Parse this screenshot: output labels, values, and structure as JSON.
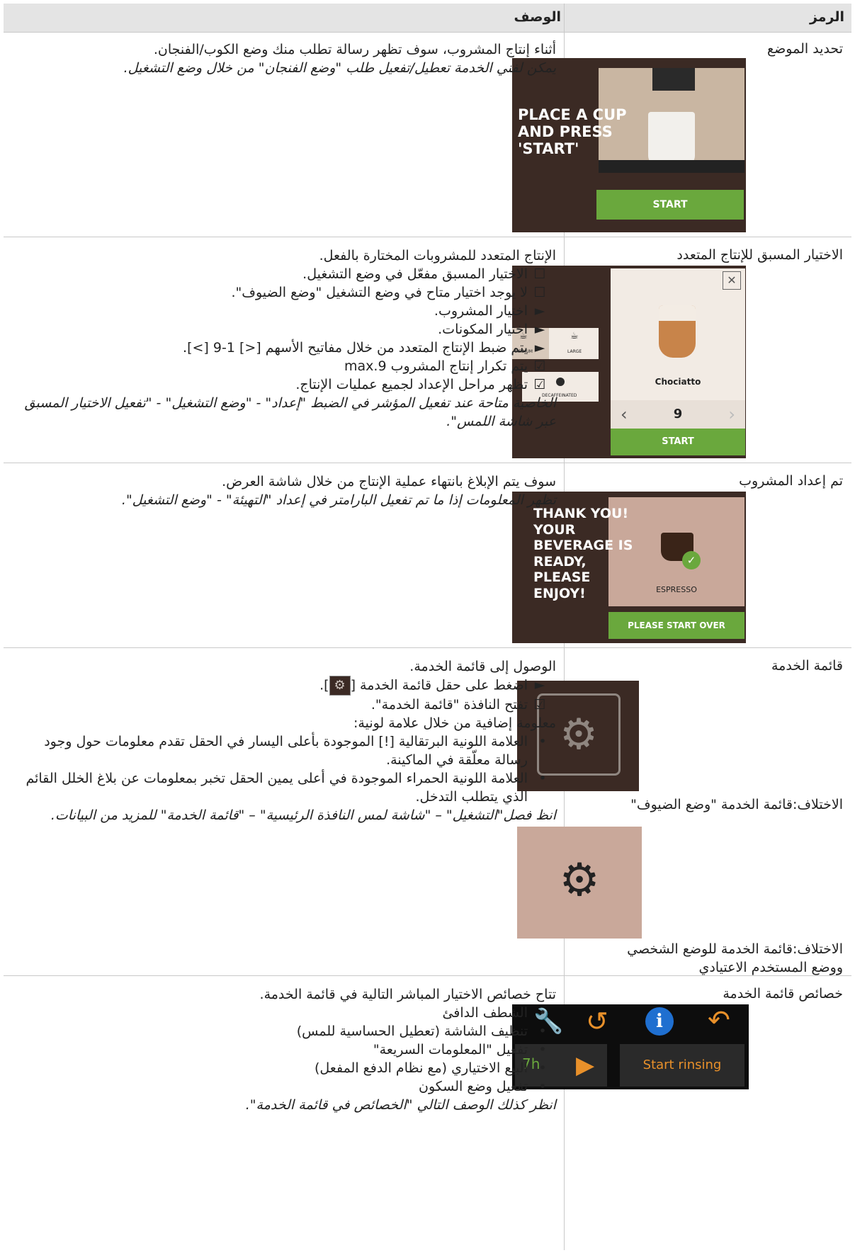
{
  "header": {
    "symbol": "الرمز",
    "description": "الوصف"
  },
  "rows": [
    {
      "symbol_title": "تحديد الموضع",
      "screen": {
        "text_lines": [
          "PLACE A CUP",
          "AND PRESS",
          "'START'"
        ],
        "button": "START"
      },
      "desc": [
        "أثناء إنتاج المشروب، سوف تظهر رسالة تطلب منك وضع الكوب/الفنجان.",
        "يمكن لفني الخدمة تعطيل/تفعيل طلب \"وضع الفنجان\" من خلال وضع التشغيل."
      ]
    },
    {
      "symbol_title": "الاختيار المسبق للإنتاج المتعدد",
      "screen": {
        "close": "✕",
        "medium": "MEDIUM",
        "large": "LARGE",
        "decaf": "DECAFFEINATED",
        "drink": "Chociatto",
        "count": "9",
        "prev": "‹",
        "next": "›",
        "button": "START"
      },
      "desc_intro": "الإنتاج المتعدد للمشروبات المختارة بالفعل.",
      "items": [
        {
          "mark": "☐",
          "text": "الاختيار المسبق مفعّل في وضع التشغيل."
        },
        {
          "mark": "☐",
          "text": "لا يوجد اختيار متاح في وضع التشغيل \"وضع الضيوف\"."
        },
        {
          "mark": "►",
          "text": "اختيار المشروب."
        },
        {
          "mark": "►",
          "text": "اختيار المكونات."
        },
        {
          "mark": "►",
          "text": "يتم ضبط الإنتاج المتعدد من خلال مفاتيح الأسهم [<] 1-9 [>]."
        },
        {
          "mark": "☑",
          "text": "يتم تكرار إنتاج المشروب 9.max"
        },
        {
          "mark": "☑",
          "text": "تظهر مراحل الإعداد لجميع عمليات الإنتاج."
        }
      ],
      "note": "الخاصية متاحة عند تفعيل المؤشر في الضبط \"إعداد\" - \"وضع التشغيل\" - \"تفعيل الاختيار المسبق عبر شاشة اللمس\"."
    },
    {
      "symbol_title": "تم إعداد المشروب",
      "screen": {
        "text_lines": [
          "THANK YOU!",
          "YOUR",
          "BEVERAGE IS",
          "READY,",
          "PLEASE",
          "ENJOY!"
        ],
        "drink": "ESPRESSO",
        "button": "PLEASE START OVER"
      },
      "desc": [
        "سوف يتم الإبلاغ بانتهاء عملية الإنتاج من خلال شاشة العرض.",
        "تظهر المعلومات إذا ما تم تفعيل البارامتر في إعداد \"التهيئة\" - \"وضع التشغيل\"."
      ]
    },
    {
      "symbol_title": "قائمة الخدمة",
      "caption1": "الاختلاف:قائمة الخدمة \"وضع الضيوف\"",
      "caption2_lines": [
        "الاختلاف:قائمة الخدمة للوضع الشخصي",
        "ووضع المستخدم الاعتيادي"
      ],
      "desc_intro": "الوصول إلى قائمة الخدمة.",
      "step1_before": "اضغط على حقل قائمة الخدمة [",
      "step1_after": "].",
      "step2": "تفتح النافذة \"قائمة الخدمة\".",
      "info": "معلومة إضافية من خلال علامة لونية:",
      "bullets": [
        "العلامة اللونية البرتقالية [!] الموجودة بأعلى اليسار في الحقل تقدم معلومات حول وجود رسالة معلّقة في الماكينة.",
        "العلامة اللونية الحمراء الموجودة في أعلى يمين الحقل تخبر بمعلومات عن بلاغ الخلل القائم الذي يتطلب التدخل."
      ],
      "note": "انظ فصل\"التشغيل\" – \"شاشة لمس النافذة الرئيسية\" – \"قائمة الخدمة\" للمزيد من البيانات."
    },
    {
      "symbol_title": "خصائص قائمة الخدمة",
      "screen": {
        "hours": "7h",
        "rinse": "Start rinsing"
      },
      "desc_intro": "تتاح خصائص الاختيار المباشر التالية في قائمة الخدمة.",
      "bullets": [
        "الشطف الدافئ",
        "تنظيف الشاشة (تعطيل الحساسية للمس)",
        "تفعيل \"المعلومات السريعة\"",
        "البيع الاختياري (مع نظام الدفع المفعل)",
        "تفعيل وضع السكون"
      ],
      "note": "انظر كذلك الوصف التالي \"الخصائص في قائمة الخدمة\"."
    }
  ]
}
